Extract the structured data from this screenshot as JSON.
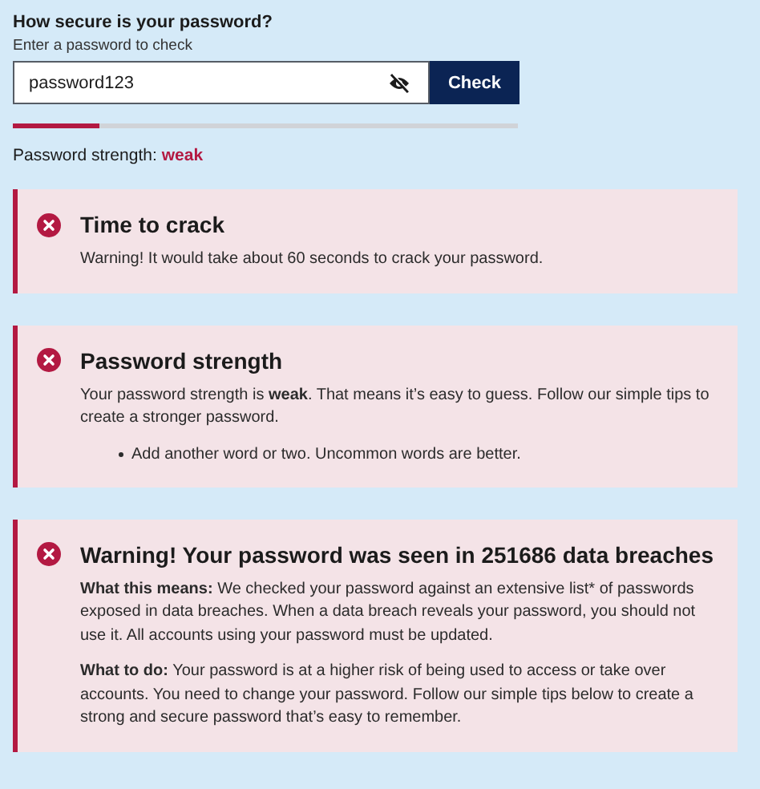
{
  "heading": "How secure is your password?",
  "hint": "Enter a password to check",
  "field": {
    "value": "password123"
  },
  "check_button": "Check",
  "meter": {
    "level": 0.17
  },
  "strength": {
    "label": "Password strength:",
    "value": "weak"
  },
  "alerts": [
    {
      "title": "Time to crack",
      "paragraphs": [
        "Warning! It would take about 60 seconds to crack your password."
      ]
    },
    {
      "title": "Password strength",
      "paragraphs": [
        "Your password strength is **weak**. That means it’s easy to guess. Follow our simple tips to create a stronger password."
      ],
      "bullets": [
        "Add another word or two. Uncommon words are better."
      ]
    },
    {
      "title": "Warning! Your password was seen in 251686 data breaches",
      "paragraphs": [
        "**What this means:** We checked your password against an extensive list* of passwords exposed in data breaches. When a data breach reveals your password, you should not use it. All accounts using your password must be updated.",
        "**What to do:** Your password is at a higher risk of being used to access or take over accounts. You need to change your password. Follow our simple tips below to create a strong and secure password that’s easy to remember."
      ]
    }
  ]
}
